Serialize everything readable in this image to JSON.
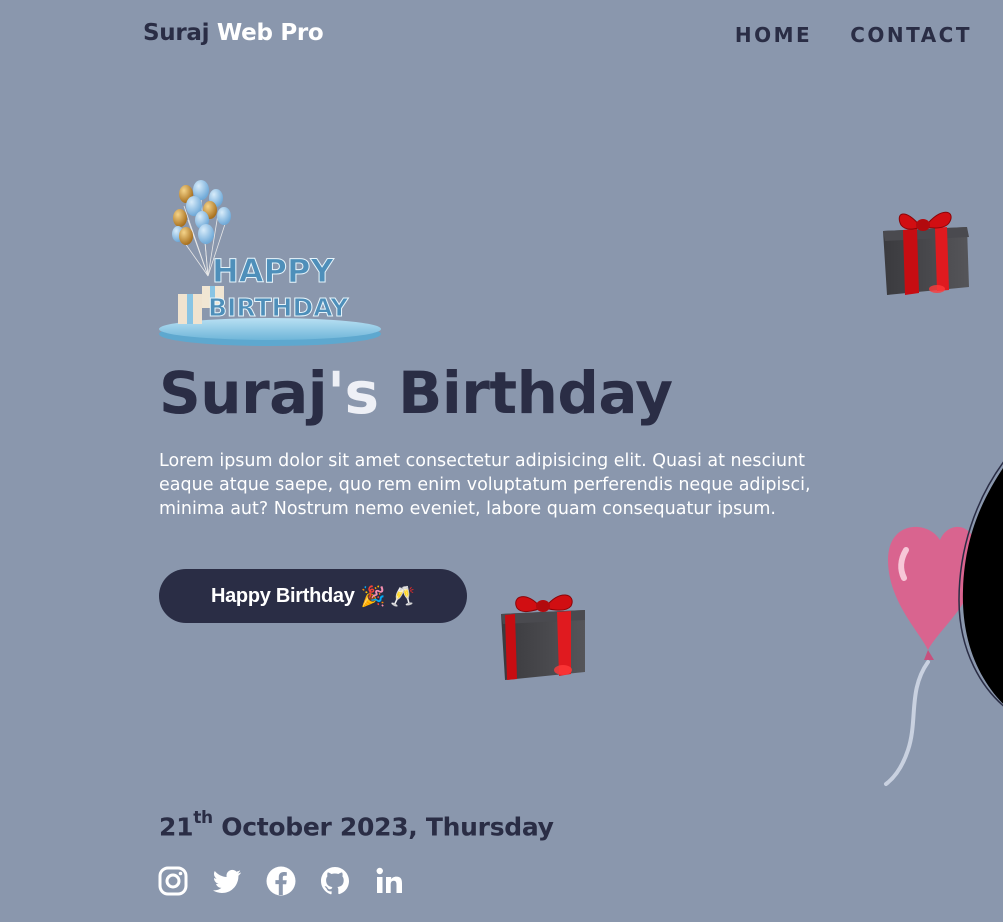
{
  "header": {
    "logo_first": "Suraj",
    "logo_second": "Web Pro",
    "nav": [
      "HOME",
      "CONTACT"
    ]
  },
  "hero": {
    "art_line1": "HAPPY",
    "art_line2": "BIRTHDAY",
    "title_name": "Suraj",
    "title_apos": "'s",
    "title_rest": "Birthday",
    "description": "Lorem ipsum dolor sit amet consectetur adipisicing elit. Quasi at nesciunt eaque atque saepe, quo rem enim voluptatum perferendis neque adipisci, minima aut? Nostrum nemo eveniet, labore quam consequatur ipsum.",
    "button_label": "Happy Birthday",
    "button_emoji": "🎉 🥂"
  },
  "event": {
    "day": "21",
    "day_suffix": "th",
    "rest": "October 2023, Thursday"
  },
  "social_icons": [
    "instagram-icon",
    "twitter-icon",
    "facebook-icon",
    "github-icon",
    "linkedin-icon"
  ],
  "colors": {
    "background": "#8a97ad",
    "dark": "#2a2d45",
    "white": "#ffffff",
    "gift_red": "#d10e12",
    "balloon_pink": "#d9648f"
  }
}
